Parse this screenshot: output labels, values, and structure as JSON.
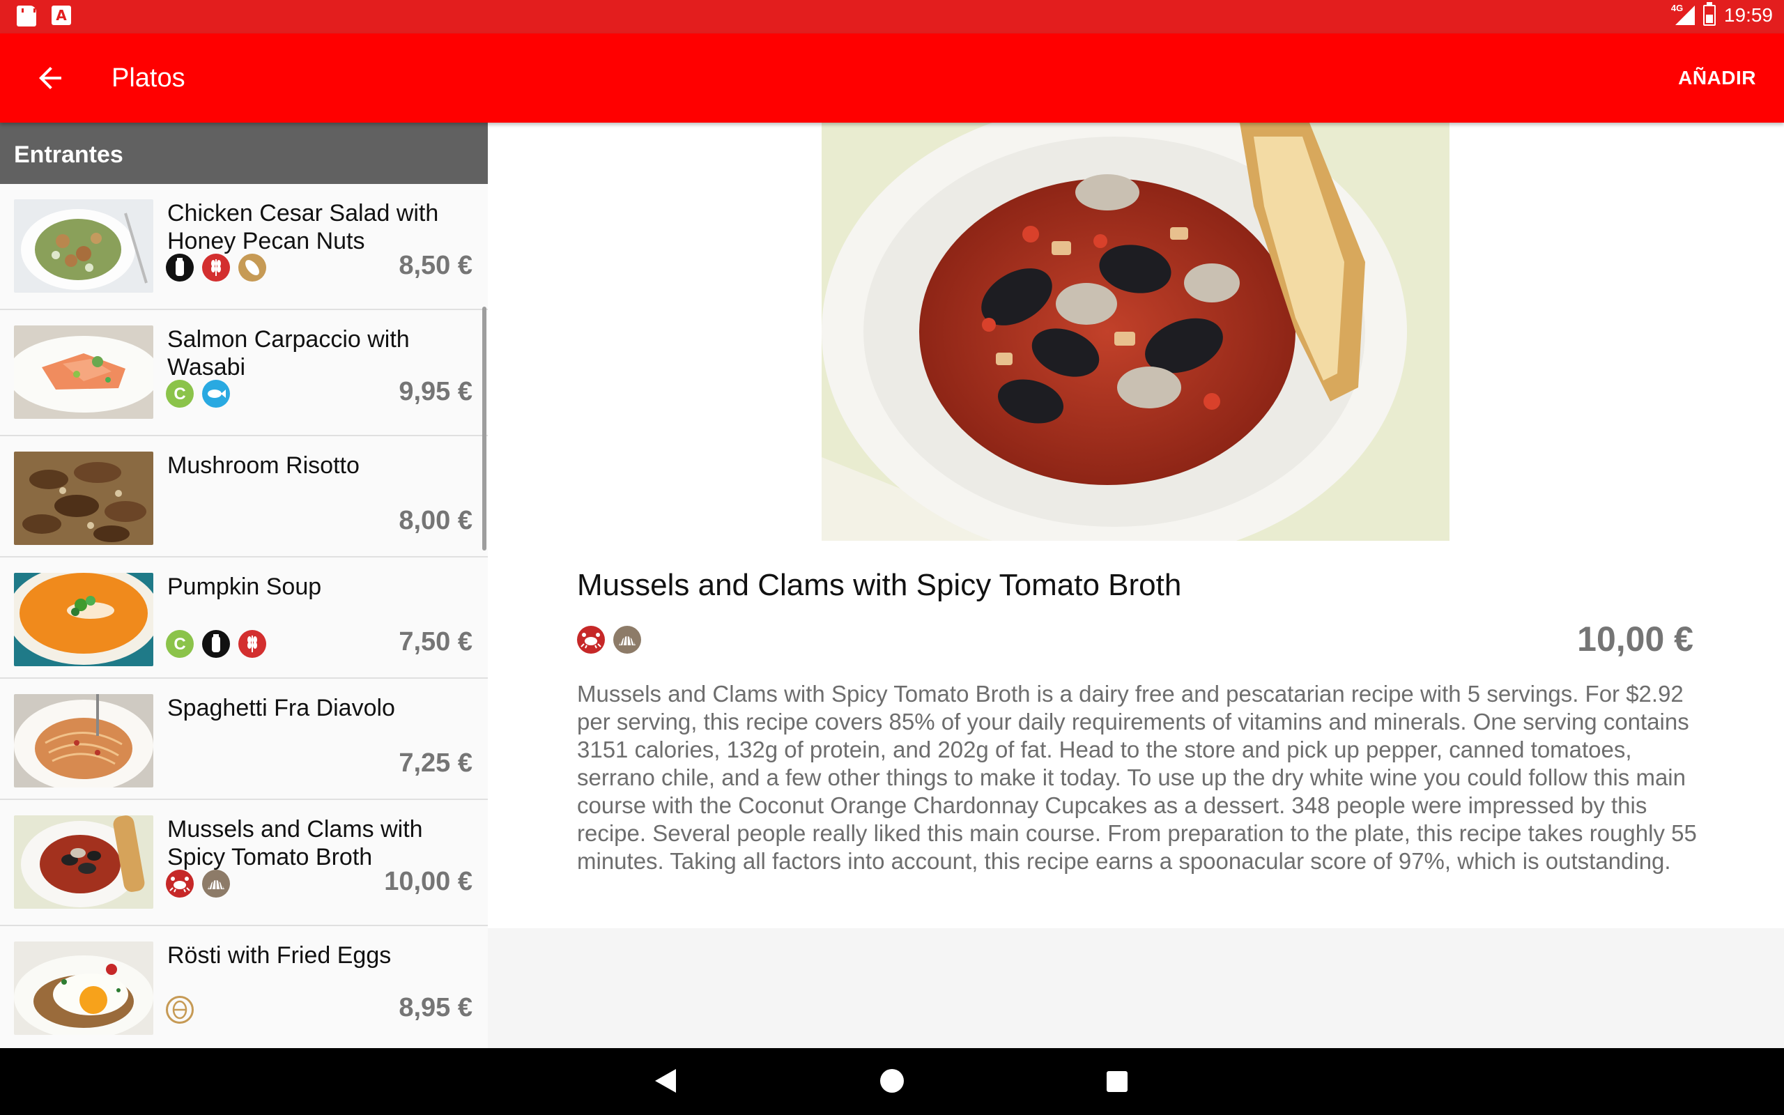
{
  "status_bar": {
    "network": "4G",
    "time": "19:59",
    "icons": [
      "sd-card-icon",
      "app-notification-icon",
      "signal-icon",
      "battery-icon"
    ]
  },
  "app_bar": {
    "title": "Platos",
    "add_label": "AÑADIR",
    "back_icon": "arrow-back-icon"
  },
  "list": {
    "section": "Entrantes",
    "items": [
      {
        "name": "Chicken Cesar Salad with Honey Pecan Nuts",
        "price": "8,50 €",
        "allergens": [
          "milk",
          "gluten",
          "peanuts"
        ]
      },
      {
        "name": "Salmon Carpaccio with Wasabi",
        "price": "9,95 €",
        "allergens": [
          "celery",
          "fish"
        ]
      },
      {
        "name": "Mushroom Risotto",
        "price": "8,00 €",
        "allergens": []
      },
      {
        "name": "Pumpkin Soup",
        "price": "7,50 €",
        "allergens": [
          "celery",
          "milk",
          "gluten"
        ]
      },
      {
        "name": "Spaghetti Fra Diavolo",
        "price": "7,25 €",
        "allergens": []
      },
      {
        "name": "Mussels and Clams with Spicy Tomato Broth",
        "price": "10,00 €",
        "allergens": [
          "crustaceans",
          "molluscs"
        ]
      },
      {
        "name": "Rösti with Fried Eggs",
        "price": "8,95 €",
        "allergens": [
          "eggs"
        ]
      }
    ]
  },
  "detail": {
    "title": "Mussels and Clams with Spicy Tomato Broth",
    "price": "10,00 €",
    "allergens": [
      "crustaceans",
      "molluscs"
    ],
    "description": "Mussels and Clams with Spicy Tomato Broth is a dairy free and pescatarian recipe with 5 servings. For $2.92 per serving, this recipe covers 85% of your daily requirements of vitamins and minerals. One serving contains 3151 calories, 132g of protein, and 202g of fat. Head to the store and pick up pepper, canned tomatoes, serrano chile, and a few other things to make it today. To use up the dry white wine you could follow this main course with the Coconut Orange Chardonnay Cupcakes as a dessert. 348 people were impressed by this recipe. Several people really liked this main course. From preparation to the plate, this recipe takes roughly 55 minutes. Taking all factors into account, this recipe earns a spoonacular score of 97%, which is outstanding."
  },
  "colors": {
    "status_bar": "#e31e1e",
    "app_bar": "#ff0000",
    "section_header": "#616161",
    "price": "#757575",
    "description": "#6d6d6d"
  }
}
